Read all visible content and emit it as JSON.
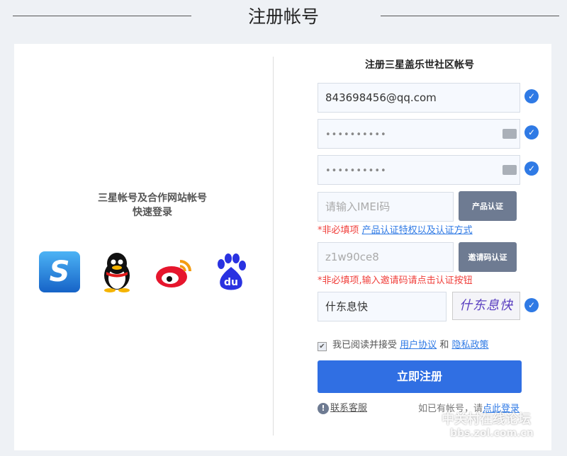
{
  "page_title": "注册帐号",
  "left": {
    "line1": "三星帐号及合作网站帐号",
    "line2": "快速登录",
    "social": [
      "samsung-s",
      "qq",
      "weibo",
      "baidu"
    ],
    "baidu_text": "du"
  },
  "form": {
    "heading": "注册三星盖乐世社区帐号",
    "email": "843698456@qq.com",
    "password": "••••••••••",
    "password_confirm": "••••••••••",
    "imei_placeholder": "请输入IMEI码",
    "product_verify_button": "产品认证",
    "imei_hint_prefix": "*非必填项",
    "imei_hint_link": "产品认证特权以及认证方式",
    "invite_code": "z1w90ce8",
    "invite_verify_button": "邀请码认证",
    "invite_hint": "*非必填项,输入邀请码请点击认证按钮",
    "captcha_value": "什东息快",
    "captcha_image_text": "什东息快",
    "agree_text": "我已阅读并接受",
    "user_agreement": "用户协议",
    "and": "和",
    "privacy_policy": "隐私政策",
    "submit": "立即注册",
    "support": "联系客服",
    "have_account": "如已有帐号，请",
    "login_link": "点此登录"
  },
  "watermark": {
    "line1": "中关村在线论坛",
    "line2": "bbs.zol.com.cn"
  },
  "colors": {
    "accent": "#306fe3",
    "gray_button": "#6e7b92",
    "hint": "#f0403c"
  }
}
